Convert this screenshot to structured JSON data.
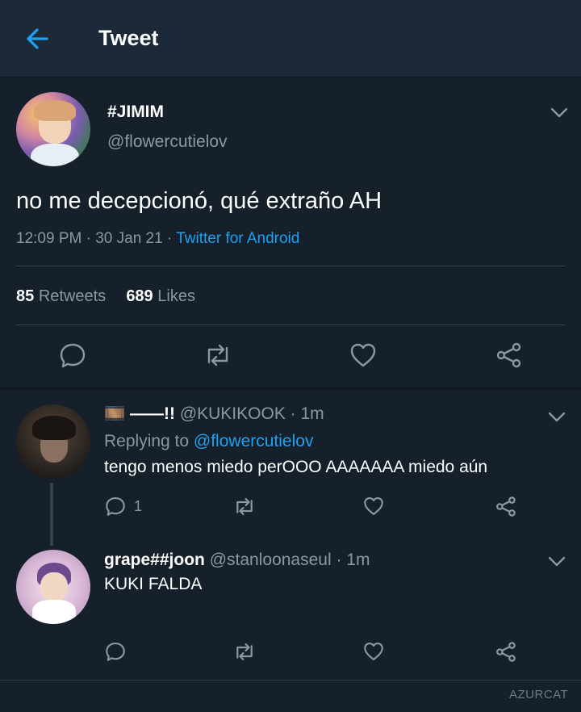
{
  "header": {
    "title": "Tweet"
  },
  "tweet": {
    "name": "#JIMIM",
    "handle": "@flowercutielov",
    "text": "no me decepcionó, qué extraño AH",
    "time": "12:09 PM · 30 Jan 21 · ",
    "source": "Twitter for Android",
    "retweets_count": "85",
    "retweets_label": "Retweets",
    "likes_count": "689",
    "likes_label": "Likes"
  },
  "replies": [
    {
      "name": "🎞️ ——!!",
      "handle": "@KUKIKOOK · 1m",
      "replying_prefix": "Replying to ",
      "replying_to": "@flowercutielov",
      "text": "tengo menos miedo perOOO AAAAAAA miedo aún",
      "reply_count": "1"
    },
    {
      "name": "grape##joon",
      "handle": "@stanloonaseul · 1m",
      "text": "KUKI FALDA"
    }
  ],
  "footer": {
    "watermark": "AZURCAT"
  },
  "colors": {
    "background": "#15202b",
    "header": "#1c2938",
    "accent": "#1da1f2",
    "muted": "#8899a6",
    "divider": "#38444d"
  }
}
